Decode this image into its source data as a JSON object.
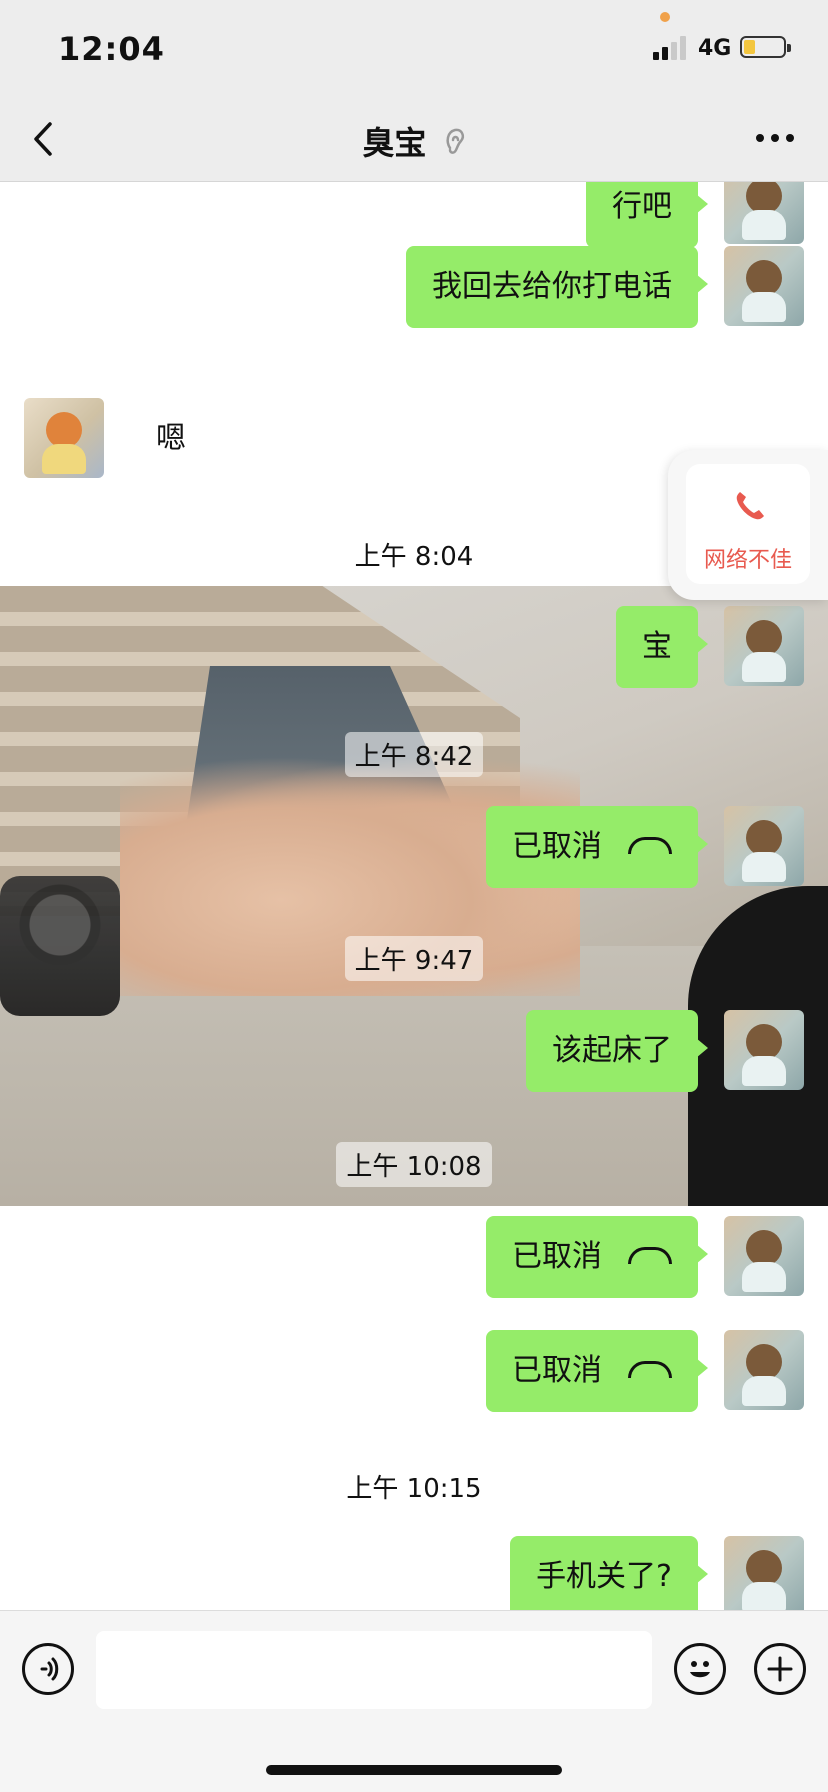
{
  "status_bar": {
    "time": "12:04",
    "network": "4G",
    "battery_level": 0.3,
    "accent_dot_color": "#f0a14a"
  },
  "header": {
    "title": "臭宝",
    "icons": {
      "back": "chevron-left-icon",
      "ear": "ear-icon",
      "more": "more-icon"
    }
  },
  "messages": [
    {
      "side": "me",
      "text": "行吧"
    },
    {
      "side": "me",
      "text": "我回去给你打电话"
    },
    {
      "side": "other",
      "text": "嗯"
    },
    {
      "type": "timestamp",
      "text": "上午 8:04"
    },
    {
      "side": "me",
      "text": "宝"
    },
    {
      "type": "timestamp",
      "text": "上午 8:42"
    },
    {
      "side": "me",
      "text": "已取消"
    },
    {
      "type": "timestamp",
      "text": "上午 9:47"
    },
    {
      "side": "me",
      "text": "该起床了"
    },
    {
      "type": "timestamp",
      "text": "上午 10:08"
    },
    {
      "side": "me",
      "text": "已取消"
    },
    {
      "side": "me",
      "text": "已取消"
    },
    {
      "type": "timestamp",
      "text": "上午 10:15"
    },
    {
      "side": "me",
      "text": "手机关了?"
    }
  ],
  "call_float": {
    "label": "网络不佳",
    "color": "#e85a4f",
    "icon": "phone-icon"
  },
  "input_bar": {
    "value": "",
    "icons": {
      "voice": "voice-icon",
      "emoji": "emoji-icon",
      "plus": "plus-icon"
    }
  },
  "colors": {
    "bubble_me": "#95ec69",
    "header_bg": "#ededed",
    "chat_bg": "#ffffff"
  }
}
